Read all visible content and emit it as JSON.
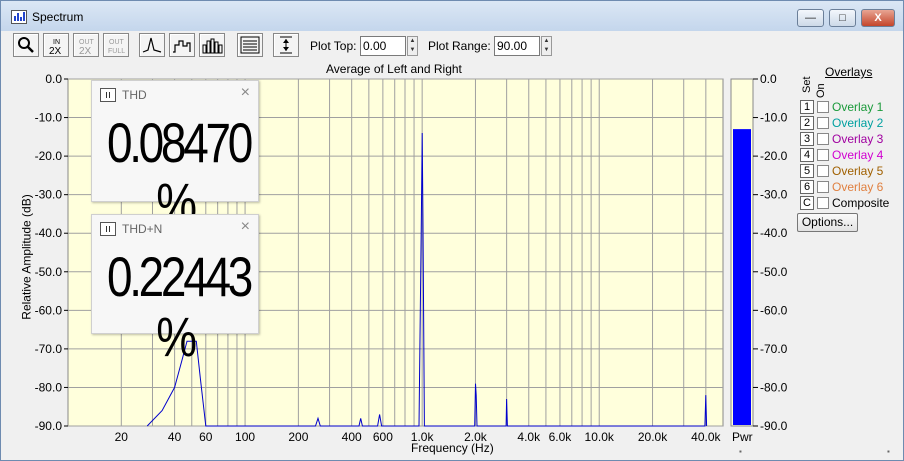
{
  "window": {
    "title": "Spectrum",
    "minimize_label": "—",
    "maximize_label": "□",
    "close_label": "X"
  },
  "toolbar": {
    "plot_top_label": "Plot Top:",
    "plot_top_value": "0.00",
    "plot_range_label": "Plot Range:",
    "plot_range_value": "90.00",
    "zoom_in_label": "IN 2X",
    "zoom_out_label": "OUT 2X",
    "zoom_full_label": "OUT FULL"
  },
  "plot": {
    "title": "Average of Left and Right",
    "ylabel": "Relative Amplitude (dB)",
    "xlabel": "Frequency (Hz)",
    "y_ticks": [
      "0.0",
      "-10.0",
      "-20.0",
      "-30.0",
      "-40.0",
      "-50.0",
      "-60.0",
      "-70.0",
      "-80.0",
      "-90.0"
    ],
    "x_ticks": [
      "20",
      "40",
      "60",
      "100",
      "200",
      "400",
      "600",
      "1.0k",
      "2.0k",
      "4.0k",
      "6.0k",
      "10.0k",
      "20.0k",
      "40.0k"
    ]
  },
  "meters": {
    "thd": {
      "name": "THD",
      "value": "0.08470 %",
      "close": "×"
    },
    "thdn": {
      "name": "THD+N",
      "value": "0.22443 %",
      "close": "×"
    }
  },
  "power_meter": {
    "label": "Pwr",
    "level_db": -13,
    "y_ticks": [
      "0.0",
      "-10.0",
      "-20.0",
      "-30.0",
      "-40.0",
      "-50.0",
      "-60.0",
      "-70.0",
      "-80.0",
      "-90.0"
    ]
  },
  "overlays": {
    "title": "Overlays",
    "set_header": "Set",
    "on_header": "On",
    "rows": [
      {
        "num": "1",
        "label": "Overlay 1",
        "color": "#1a9a3a"
      },
      {
        "num": "2",
        "label": "Overlay 2",
        "color": "#00a0a0"
      },
      {
        "num": "3",
        "label": "Overlay 3",
        "color": "#a000a0"
      },
      {
        "num": "4",
        "label": "Overlay 4",
        "color": "#d000d0"
      },
      {
        "num": "5",
        "label": "Overlay 5",
        "color": "#a06000"
      },
      {
        "num": "6",
        "label": "Overlay 6",
        "color": "#e08040"
      },
      {
        "num": "C",
        "label": "Composite",
        "color": "#000000"
      }
    ],
    "options_label": "Options..."
  },
  "chart_data": {
    "type": "line",
    "title": "Average of Left and Right",
    "xlabel": "Frequency (Hz)",
    "ylabel": "Relative Amplitude (dB)",
    "x_scale": "log",
    "xlim": [
      10,
      50000
    ],
    "ylim": [
      -90,
      0
    ],
    "grid": true,
    "series": [
      {
        "color": "#0000cc",
        "x": [
          28,
          34,
          40,
          44,
          47,
          50,
          53,
          56,
          60,
          250,
          258,
          266,
          440,
          450,
          460,
          560,
          575,
          590,
          960,
          990,
          1000,
          1010,
          1030,
          1980,
          2000,
          2020,
          2040,
          2980,
          3000,
          3030,
          39500,
          40000,
          40400
        ],
        "y": [
          -90,
          -86,
          -80,
          -73,
          -68,
          -68,
          -68,
          -78,
          -90,
          -90,
          -88,
          -90,
          -90,
          -88,
          -90,
          -90,
          -87,
          -90,
          -90,
          -35,
          -14,
          -35,
          -90,
          -90,
          -79,
          -82,
          -90,
          -90,
          -83,
          -90,
          -90,
          -82,
          -90
        ]
      }
    ]
  }
}
